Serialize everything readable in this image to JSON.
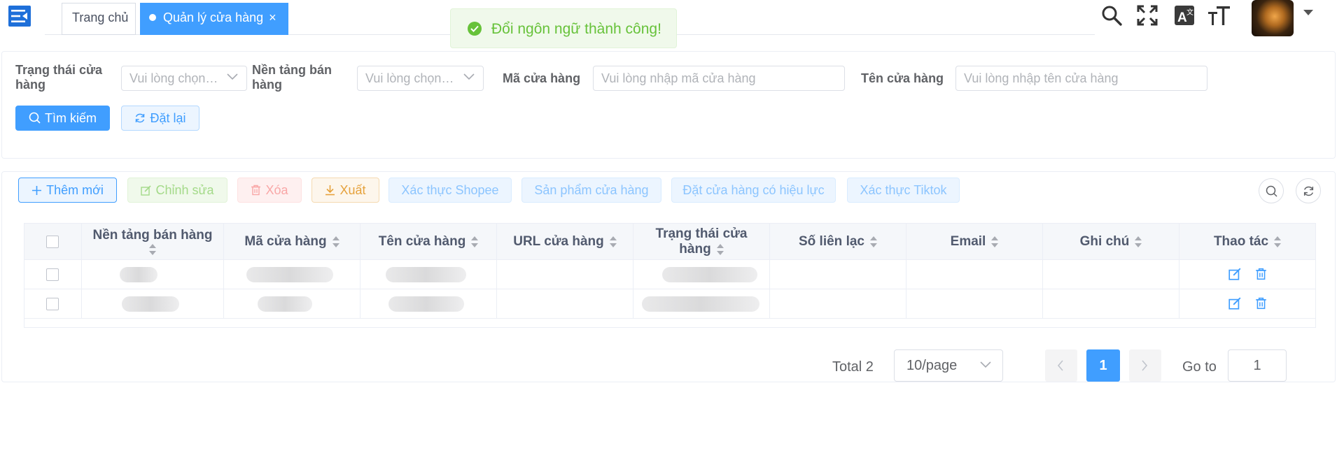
{
  "header": {
    "tabs": [
      {
        "label": "Trang chủ",
        "active": false
      },
      {
        "label": "Quản lý cửa hàng",
        "active": true,
        "close": "×"
      }
    ],
    "toast": {
      "message": "Đổi ngôn ngữ thành công!",
      "type": "success"
    },
    "icons": [
      "menu-toggle-icon",
      "search-icon",
      "fullscreen-icon",
      "translate-icon",
      "font-size-icon",
      "avatar",
      "caret-down-icon"
    ]
  },
  "search_form": {
    "fields": [
      {
        "label": "Trạng thái cửa hàng",
        "placeholder": "Vui lòng chọn…",
        "type": "select"
      },
      {
        "label": "Nền tảng bán hàng",
        "placeholder": "Vui lòng chọn…",
        "type": "select"
      },
      {
        "label": "Mã cửa hàng",
        "placeholder": "Vui lòng nhập mã cửa hàng",
        "type": "input"
      },
      {
        "label": "Tên cửa hàng",
        "placeholder": "Vui lòng nhập tên cửa hàng",
        "type": "input"
      }
    ],
    "search_label": "Tìm kiếm",
    "reset_label": "Đặt lại"
  },
  "toolbar": {
    "add_label": "Thêm mới",
    "edit_label": "Chỉnh sửa",
    "delete_label": "Xóa",
    "export_label": "Xuất",
    "shopee_label": "Xác thực Shopee",
    "products_label": "Sản phẩm cửa hàng",
    "activate_label": "Đặt cửa hàng có hiệu lực",
    "tiktok_label": "Xác thực Tiktok"
  },
  "table": {
    "columns": [
      "Nền tảng bán hàng",
      "Mã cửa hàng",
      "Tên cửa hàng",
      "URL cửa hàng",
      "Trạng thái cửa hàng",
      "Số liên lạc",
      "Email",
      "Ghi chú",
      "Thao tác"
    ],
    "rows": [
      {
        "platform": "",
        "code": "",
        "name": "",
        "url": "",
        "status": "",
        "phone": "",
        "email": "",
        "note": ""
      },
      {
        "platform": "",
        "code": "",
        "name": "",
        "url": "",
        "status": "",
        "phone": "",
        "email": "",
        "note": ""
      }
    ]
  },
  "pagination": {
    "total_label": "Total 2",
    "page_size": "10/page",
    "current_page": "1",
    "goto_label": "Go to",
    "goto_value": "1"
  },
  "colors": {
    "primary": "#409eff",
    "success": "#67c23a",
    "warning": "#e6a23c",
    "danger": "#f56c6c"
  }
}
